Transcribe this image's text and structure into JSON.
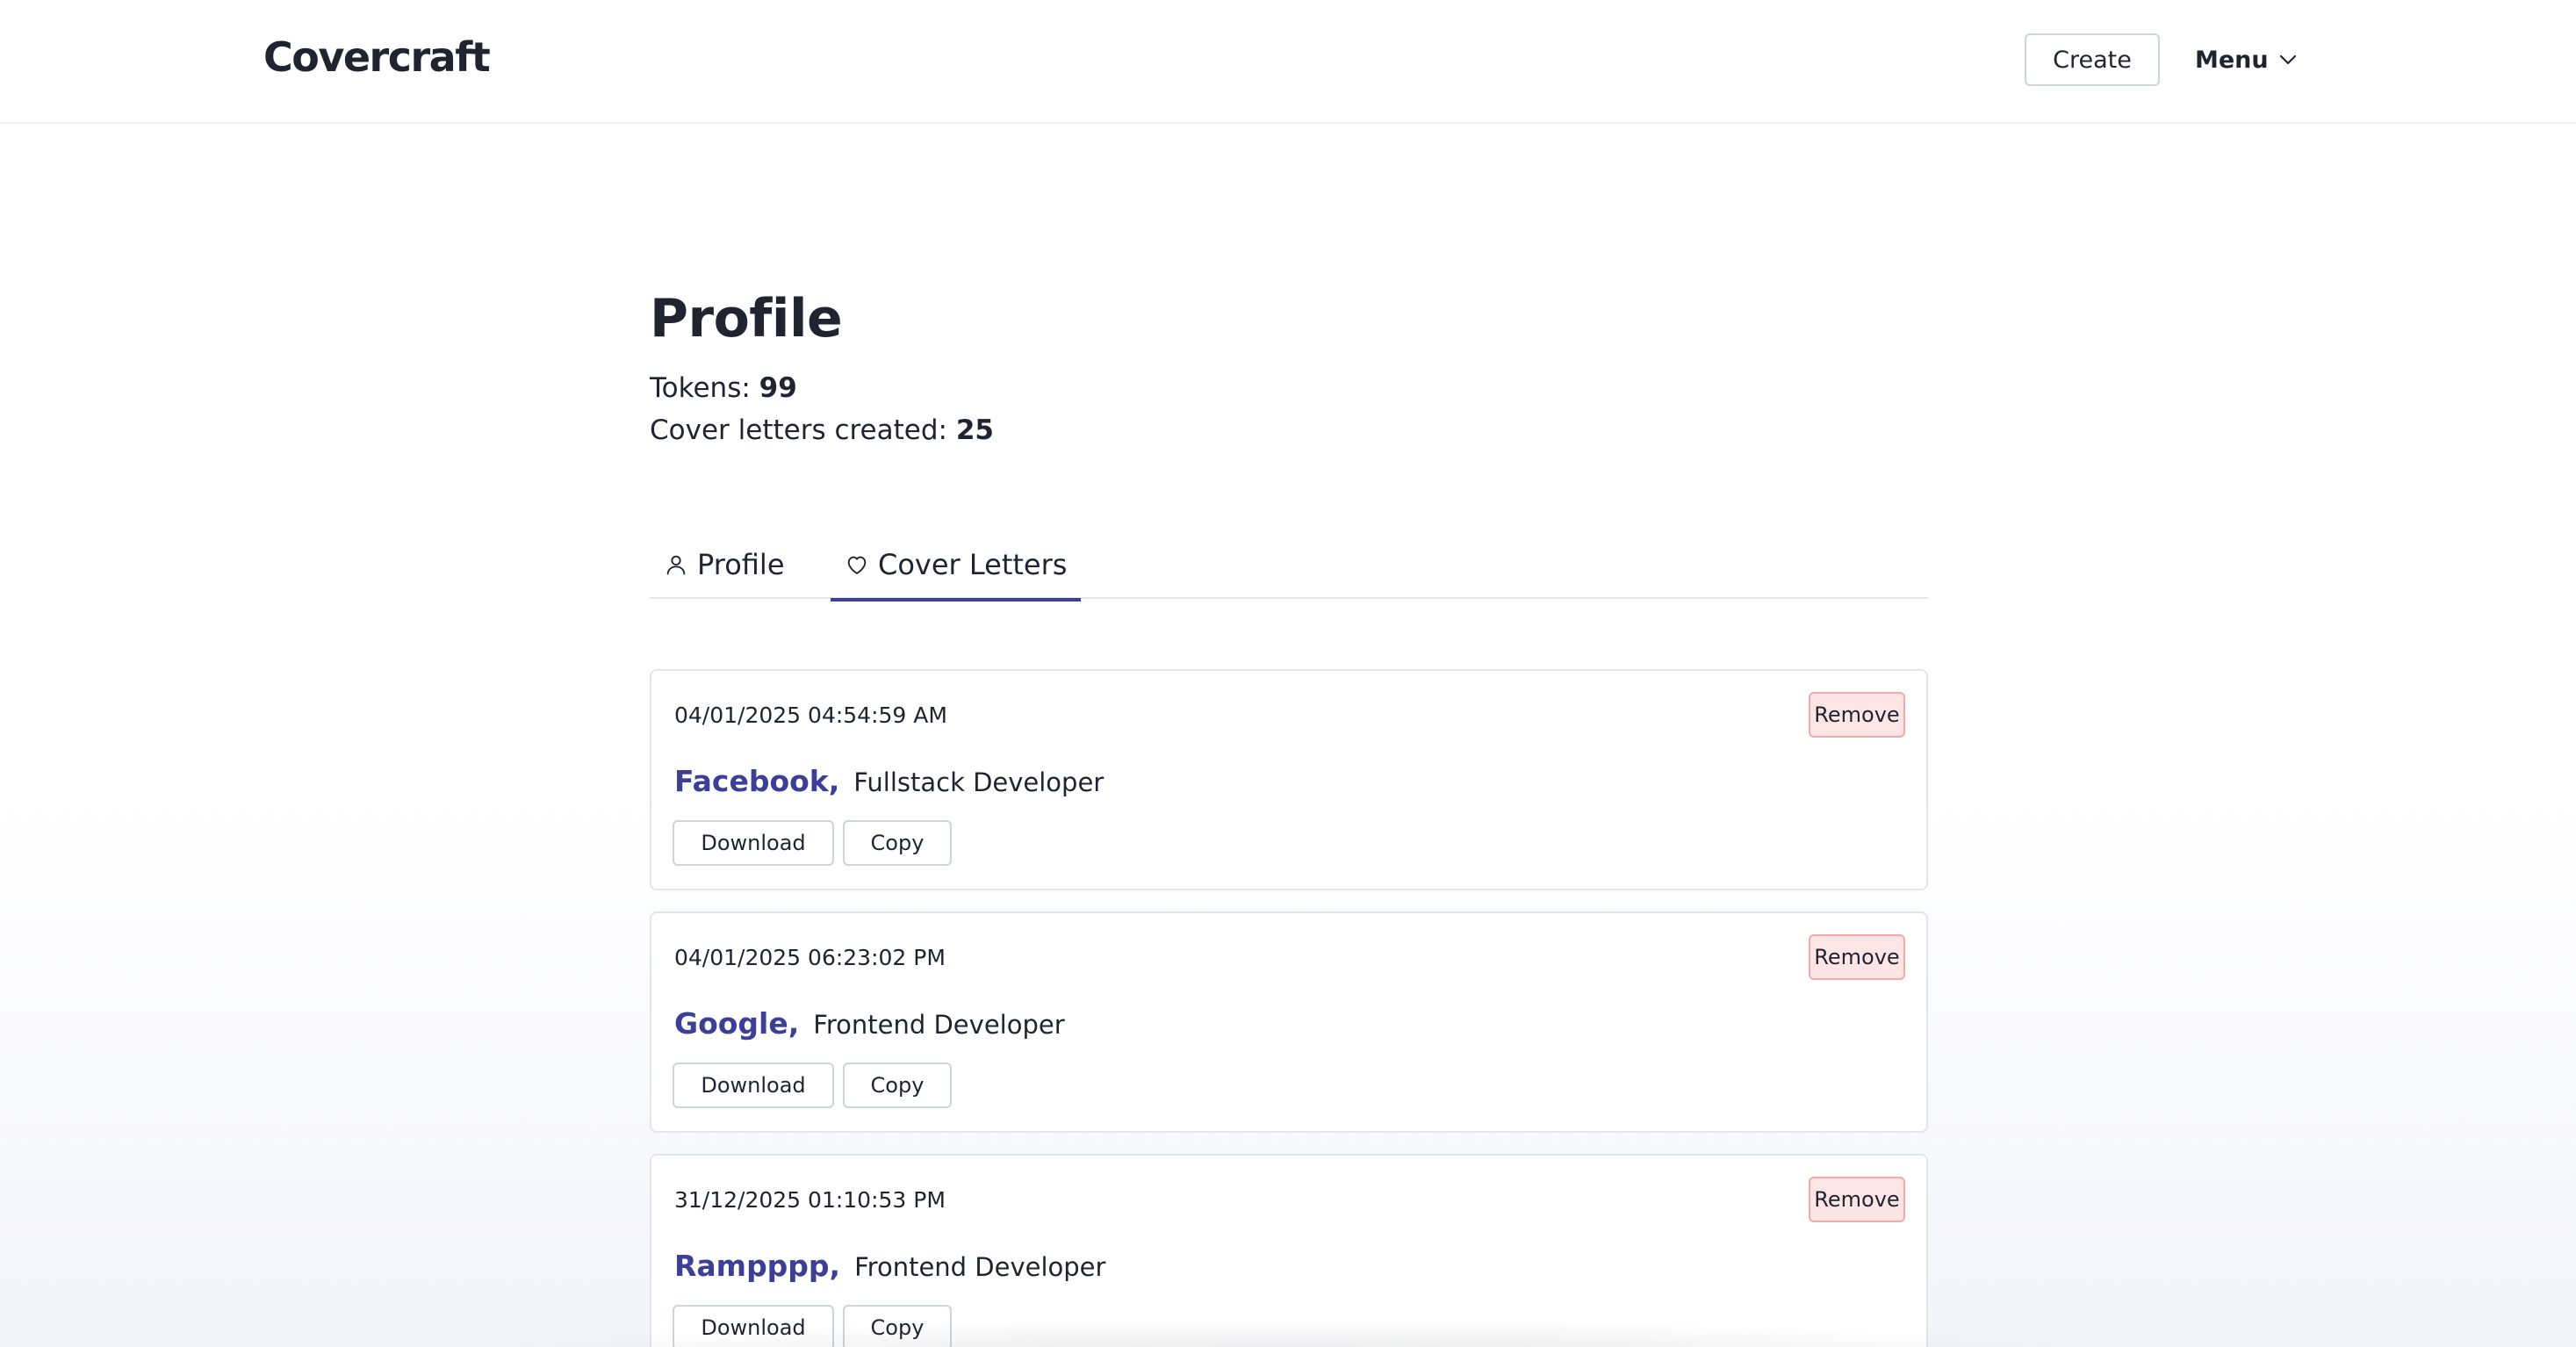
{
  "header": {
    "logo": "Covercraft",
    "create_label": "Create",
    "menu_label": "Menu"
  },
  "profile": {
    "title": "Profile",
    "tokens_label": "Tokens:",
    "tokens_value": "99",
    "letters_label": "Cover letters created:",
    "letters_value": "25"
  },
  "tabs": [
    {
      "label": "Profile",
      "icon": "user-icon",
      "active": false
    },
    {
      "label": "Cover Letters",
      "icon": "heart-icon",
      "active": true
    }
  ],
  "cards": [
    {
      "date": "04/01/2025 04:54:59 AM",
      "company": "Facebook,",
      "role": "Fullstack Developer",
      "remove_label": "Remove",
      "download_label": "Download",
      "copy_label": "Copy"
    },
    {
      "date": "04/01/2025 06:23:02 PM",
      "company": "Google,",
      "role": "Frontend Developer",
      "remove_label": "Remove",
      "download_label": "Download",
      "copy_label": "Copy"
    },
    {
      "date": "31/12/2025 01:10:53 PM",
      "company": "Rampppp,",
      "role": "Frontend Developer",
      "remove_label": "Remove",
      "download_label": "Download",
      "copy_label": "Copy"
    }
  ],
  "colors": {
    "accent": "#3b3f98",
    "remove_bg": "#fde5e5",
    "remove_border": "#f2a9a9",
    "text": "#1f2430"
  }
}
